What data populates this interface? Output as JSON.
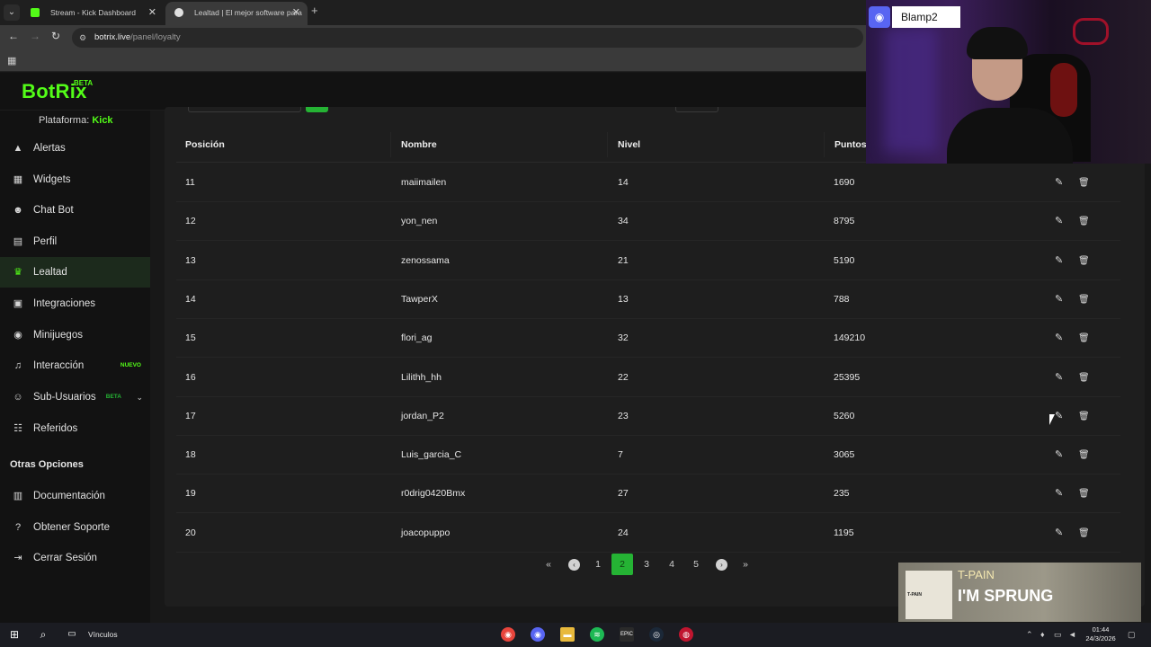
{
  "browser": {
    "tabs": [
      {
        "title": "Stream - Kick Dashboard",
        "active": false,
        "favicon_color": "#53fc18"
      },
      {
        "title": "Lealtad | El mejor software para",
        "active": true,
        "favicon_color": "#e0e0e0"
      }
    ],
    "url_host": "botrix.live",
    "url_path": "/panel/loyalty"
  },
  "app": {
    "logo": "BotRix",
    "logo_badge": "BETA",
    "platform_label": "Plataforma:",
    "platform_value": "Kick",
    "accent": "#53fc18"
  },
  "sidebar": {
    "items": [
      {
        "label": "Alertas",
        "icon": "warning-icon"
      },
      {
        "label": "Widgets",
        "icon": "widgets-icon"
      },
      {
        "label": "Chat Bot",
        "icon": "robot-icon"
      },
      {
        "label": "Perfil",
        "icon": "profile-card-icon"
      },
      {
        "label": "Lealtad",
        "icon": "trophy-icon",
        "active": true
      },
      {
        "label": "Integraciones",
        "icon": "integrations-icon"
      },
      {
        "label": "Minijuegos",
        "icon": "gamepad-icon"
      },
      {
        "label": "Interacción",
        "icon": "music-icon",
        "badge": "NUEVO",
        "badge_color": "#53fc18"
      },
      {
        "label": "Sub-Usuarios",
        "icon": "users-icon",
        "badge": "BETA",
        "badge_color": "#25b334"
      },
      {
        "label": "Referidos",
        "icon": "referrals-icon"
      }
    ],
    "section_title": "Otras Opciones",
    "other_items": [
      {
        "label": "Documentación",
        "icon": "docs-icon"
      },
      {
        "label": "Obtener Soporte",
        "icon": "help-icon"
      },
      {
        "label": "Cerrar Sesión",
        "icon": "logout-icon"
      }
    ]
  },
  "table": {
    "headers": [
      "Posición",
      "Nombre",
      "Nivel",
      "Puntos"
    ],
    "rows": [
      {
        "pos": "11",
        "name": "maiimailen",
        "level": "14",
        "points": "1690"
      },
      {
        "pos": "12",
        "name": "yon_nen",
        "level": "34",
        "points": "8795"
      },
      {
        "pos": "13",
        "name": "zenossama",
        "level": "21",
        "points": "5190"
      },
      {
        "pos": "14",
        "name": "TawperX",
        "level": "13",
        "points": "788"
      },
      {
        "pos": "15",
        "name": "flori_ag",
        "level": "32",
        "points": "149210"
      },
      {
        "pos": "16",
        "name": "Lilithh_hh",
        "level": "22",
        "points": "25395"
      },
      {
        "pos": "17",
        "name": "jordan_P2",
        "level": "23",
        "points": "5260"
      },
      {
        "pos": "18",
        "name": "Luis_garcia_C",
        "level": "7",
        "points": "3065"
      },
      {
        "pos": "19",
        "name": "r0drig0420Bmx",
        "level": "27",
        "points": "235"
      },
      {
        "pos": "20",
        "name": "joacopuppo",
        "level": "24",
        "points": "1195"
      }
    ]
  },
  "pagination": {
    "first": "«",
    "prev": "‹",
    "pages": [
      "1",
      "2",
      "3",
      "4",
      "5"
    ],
    "current": "2",
    "next": "›",
    "last": "»"
  },
  "overlay": {
    "discord_name": "Blamp2",
    "now_playing_artist": "T-PAIN",
    "now_playing_title": "I'M SPRUNG",
    "album_label": "T-PAIN"
  },
  "taskbar": {
    "toolbar_label": "Vínculos",
    "time": "01:44",
    "date": "24/3/2026"
  }
}
